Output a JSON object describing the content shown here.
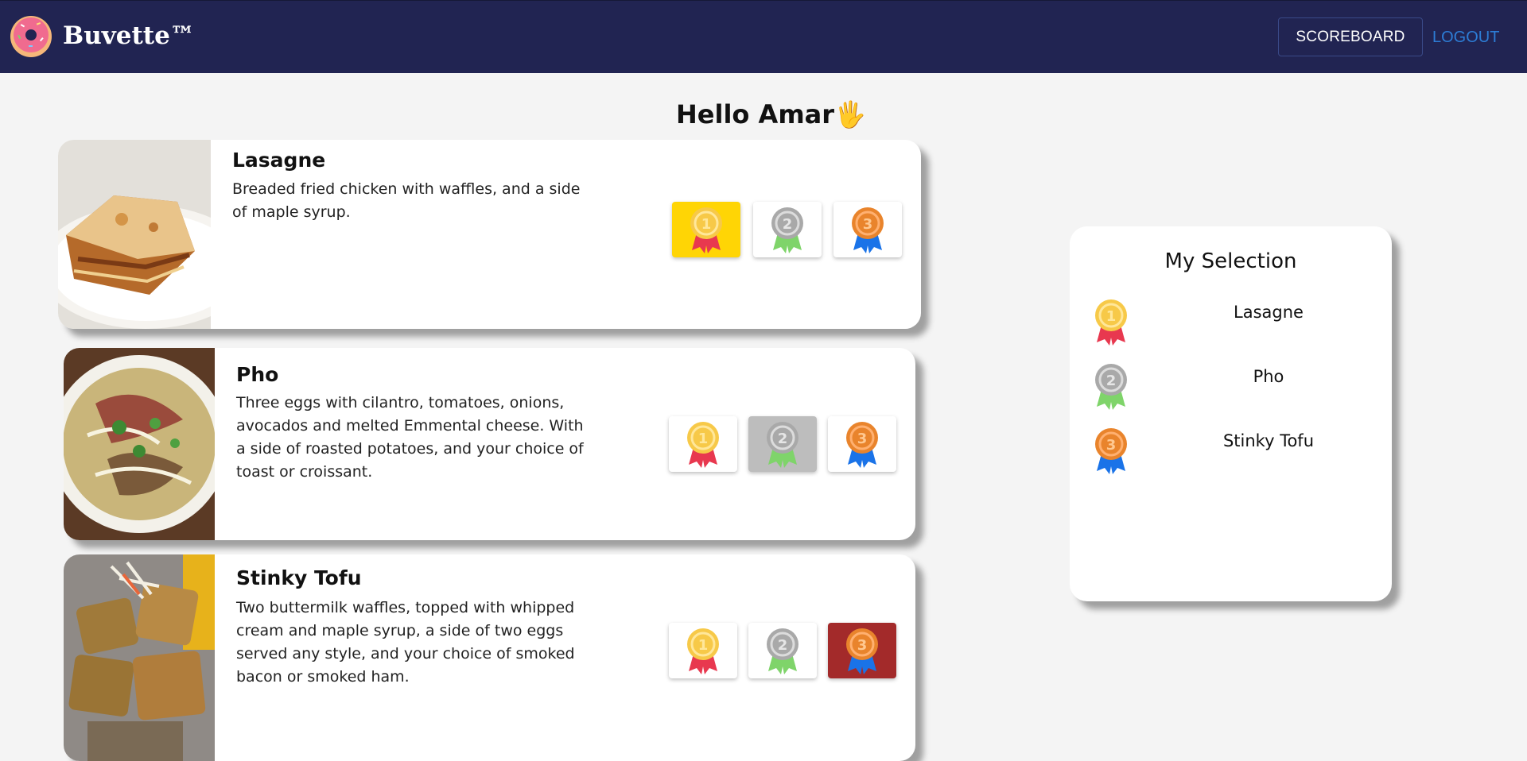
{
  "navbar": {
    "brand": "Buvette™",
    "logo_icon": "donut-icon",
    "scoreboard_label": "SCOREBOARD",
    "logout_label": "LOGOUT",
    "background": "#212452"
  },
  "greeting": {
    "text": "Hello Amar",
    "emoji": "🖐"
  },
  "dishes": [
    {
      "name": "Lasagne",
      "description": "Breaded fried chicken with waffles, and a side of maple syrup.",
      "image": "lasagne-photo",
      "selected_rank": 1
    },
    {
      "name": "Pho",
      "description": "Three eggs with cilantro, tomatoes, onions, avocados and melted Emmental cheese. With a side of roasted potatoes, and your choice of toast or croissant.",
      "image": "pho-photo",
      "selected_rank": 2
    },
    {
      "name": "Stinky Tofu",
      "description": "Two buttermilk waffles, topped with whipped cream and maple syrup, a side of two eggs served any style, and your choice of smoked bacon or smoked ham.",
      "image": "stinky-tofu-photo",
      "selected_rank": 3
    }
  ],
  "medals": [
    {
      "number": "1",
      "icon": "gold-medal-icon",
      "coin": "#f7c948",
      "ribbon": "#e8384f"
    },
    {
      "number": "2",
      "icon": "silver-medal-icon",
      "coin": "#a9a9a9",
      "ribbon": "#7fd46a"
    },
    {
      "number": "3",
      "icon": "bronze-medal-icon",
      "coin": "#e9842c",
      "ribbon": "#1a73e8"
    }
  ],
  "selection": {
    "title": "My Selection",
    "items": [
      {
        "rank": "1",
        "name": "Lasagne"
      },
      {
        "rank": "2",
        "name": "Pho"
      },
      {
        "rank": "3",
        "name": "Stinky Tofu"
      }
    ]
  },
  "colors": {
    "selected_gold_bg": "#ffd505",
    "selected_silver_bg": "#bdbdbd",
    "selected_bronze_bg": "#a32a2a",
    "link_blue": "#2d7dd6"
  }
}
